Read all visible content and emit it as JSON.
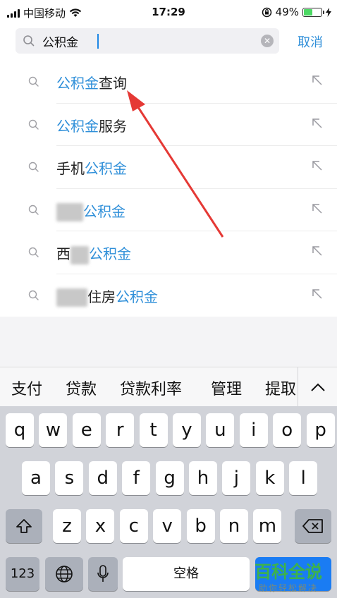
{
  "status": {
    "carrier": "中国移动",
    "time": "17:29",
    "battery": "49%",
    "battery_level": 0.49
  },
  "search": {
    "value": "公积金",
    "cancel_label": "取消"
  },
  "suggestions": [
    {
      "pre": "",
      "hl": "公积金",
      "post": "查询"
    },
    {
      "pre": "",
      "hl": "公积金",
      "post": "服务"
    },
    {
      "pre": "手机",
      "hl": "公积金",
      "post": ""
    },
    {
      "pre": "",
      "hl": "公积金",
      "post": ""
    },
    {
      "pre": "西",
      "hl": "公积金",
      "post": ""
    },
    {
      "pre": "住房",
      "hl": "公积金",
      "post": ""
    }
  ],
  "candidates": [
    "支付",
    "贷款",
    "贷款利率",
    "管理",
    "提取"
  ],
  "keyboard": {
    "row1": [
      "q",
      "w",
      "e",
      "r",
      "t",
      "y",
      "u",
      "i",
      "o",
      "p"
    ],
    "row2": [
      "a",
      "s",
      "d",
      "f",
      "g",
      "h",
      "j",
      "k",
      "l"
    ],
    "row3": [
      "z",
      "x",
      "c",
      "v",
      "b",
      "n",
      "m"
    ],
    "numbers_label": "123",
    "space_label": "空格"
  },
  "watermark": {
    "title": "百科全说",
    "subtitle": "助你轻松解决"
  }
}
